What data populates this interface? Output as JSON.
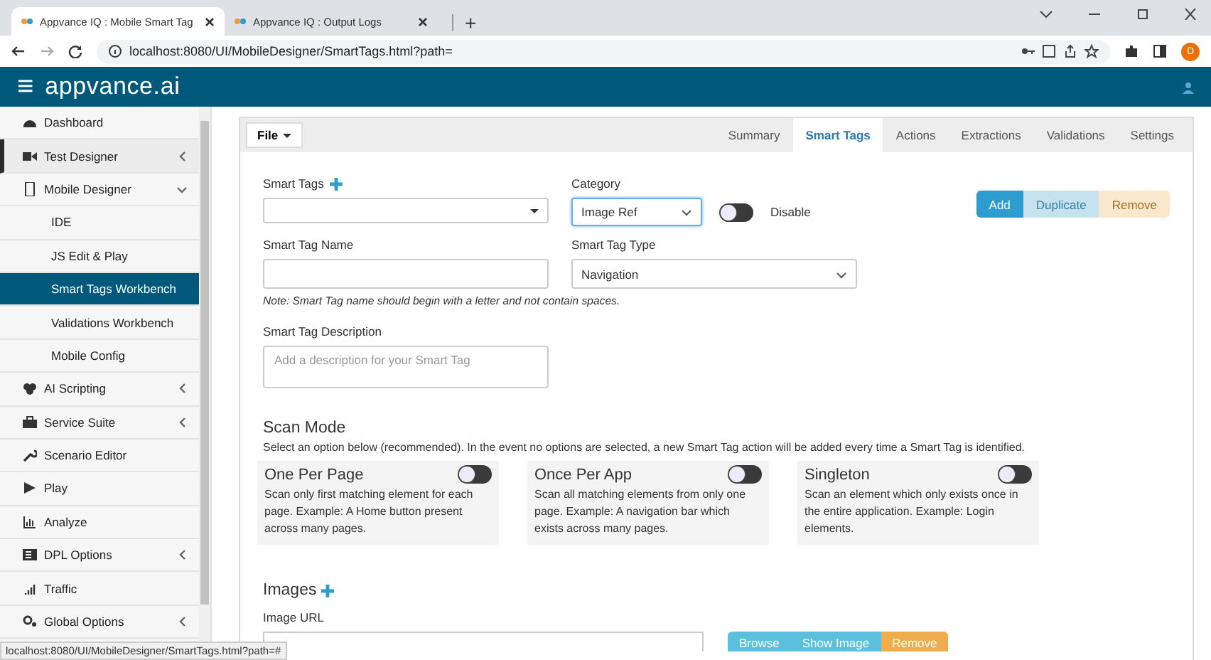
{
  "browser": {
    "tabs": [
      {
        "title": "Appvance IQ : Mobile Smart Tag",
        "selected": true
      },
      {
        "title": "Appvance IQ : Output Logs",
        "selected": false
      }
    ],
    "new_tab": "+",
    "address": "localhost:8080/UI/MobileDesigner/SmartTags.html?path=",
    "profile": "D"
  },
  "header": {
    "menu": "≡",
    "brand": "appvance.ai"
  },
  "sidebar": {
    "items": [
      {
        "label": "Dashboard",
        "kind": "main",
        "selected": false,
        "current": false,
        "expandable": false,
        "expanded": false
      },
      {
        "label": "Test Designer",
        "kind": "main",
        "selected": false,
        "current": true,
        "expandable": true,
        "expanded": false
      },
      {
        "label": "Mobile Designer",
        "kind": "main",
        "selected": false,
        "current": false,
        "expandable": true,
        "expanded": true
      },
      {
        "label": "IDE",
        "kind": "sub",
        "selected": false,
        "current": false,
        "expandable": false,
        "expanded": false
      },
      {
        "label": "JS Edit & Play",
        "kind": "sub",
        "selected": false,
        "current": false,
        "expandable": false,
        "expanded": false
      },
      {
        "label": "Smart Tags Workbench",
        "kind": "sub",
        "selected": true,
        "current": false,
        "expandable": false,
        "expanded": false
      },
      {
        "label": "Validations Workbench",
        "kind": "sub",
        "selected": false,
        "current": false,
        "expandable": false,
        "expanded": false
      },
      {
        "label": "Mobile Config",
        "kind": "sub",
        "selected": false,
        "current": false,
        "expandable": false,
        "expanded": false
      },
      {
        "label": "AI Scripting",
        "kind": "main",
        "selected": false,
        "current": false,
        "expandable": true,
        "expanded": false
      },
      {
        "label": "Service Suite",
        "kind": "main",
        "selected": false,
        "current": false,
        "expandable": true,
        "expanded": false
      },
      {
        "label": "Scenario Editor",
        "kind": "main",
        "selected": false,
        "current": false,
        "expandable": false,
        "expanded": false
      },
      {
        "label": "Play",
        "kind": "main",
        "selected": false,
        "current": false,
        "expandable": false,
        "expanded": false
      },
      {
        "label": "Analyze",
        "kind": "main",
        "selected": false,
        "current": false,
        "expandable": false,
        "expanded": false
      },
      {
        "label": "DPL Options",
        "kind": "main",
        "selected": false,
        "current": false,
        "expandable": true,
        "expanded": false
      },
      {
        "label": "Traffic",
        "kind": "main",
        "selected": false,
        "current": false,
        "expandable": false,
        "expanded": false
      },
      {
        "label": "Global Options",
        "kind": "main",
        "selected": false,
        "current": false,
        "expandable": true,
        "expanded": false
      }
    ]
  },
  "toolbar": {
    "file_menu": "File",
    "tabs": [
      {
        "label": "Summary",
        "selected": false
      },
      {
        "label": "Smart Tags",
        "selected": true
      },
      {
        "label": "Actions",
        "selected": false
      },
      {
        "label": "Extractions",
        "selected": false
      },
      {
        "label": "Validations",
        "selected": false
      },
      {
        "label": "Settings",
        "selected": false
      }
    ]
  },
  "form": {
    "smart_tags_label": "Smart Tags",
    "category_label": "Category",
    "category_value": "Image Ref",
    "disable_toggle": {
      "label": "Disable",
      "on": false
    },
    "actions": [
      {
        "label": "Add",
        "kind": "primary",
        "disabled": false
      },
      {
        "label": "Duplicate",
        "kind": "info",
        "disabled": true
      },
      {
        "label": "Remove",
        "kind": "warning",
        "disabled": true
      }
    ],
    "name_label": "Smart Tag Name",
    "type_label": "Smart Tag Type",
    "type_value": "Navigation",
    "note": "Note: Smart Tag name should begin with a letter and not contain spaces.",
    "description_label": "Smart Tag Description",
    "description_placeholder": "Add a description for your Smart Tag"
  },
  "scan_mode": {
    "title": "Scan Mode",
    "hint": "Select an option below (recommended). In the event no options are selected, a new Smart Tag action will be added every time a Smart Tag is identified.",
    "options": [
      {
        "title": "One Per Page",
        "text": "Scan only first matching element for each page. Example: A Home button present across many pages.",
        "on": false
      },
      {
        "title": "Once Per App",
        "text": "Scan all matching elements from only one page. Example: A navigation bar which exists across many pages.",
        "on": false
      },
      {
        "title": "Singleton",
        "text": "Scan an element which only exists once in the entire application. Example: Login elements.",
        "on": false
      }
    ]
  },
  "images": {
    "title": "Images",
    "url_label": "Image URL",
    "buttons": [
      {
        "label": "Browse",
        "kind": "info"
      },
      {
        "label": "Show Image",
        "kind": "info"
      },
      {
        "label": "Remove",
        "kind": "warning"
      }
    ]
  },
  "status_bar": "localhost:8080/UI/MobileDesigner/SmartTags.html?path=#"
}
